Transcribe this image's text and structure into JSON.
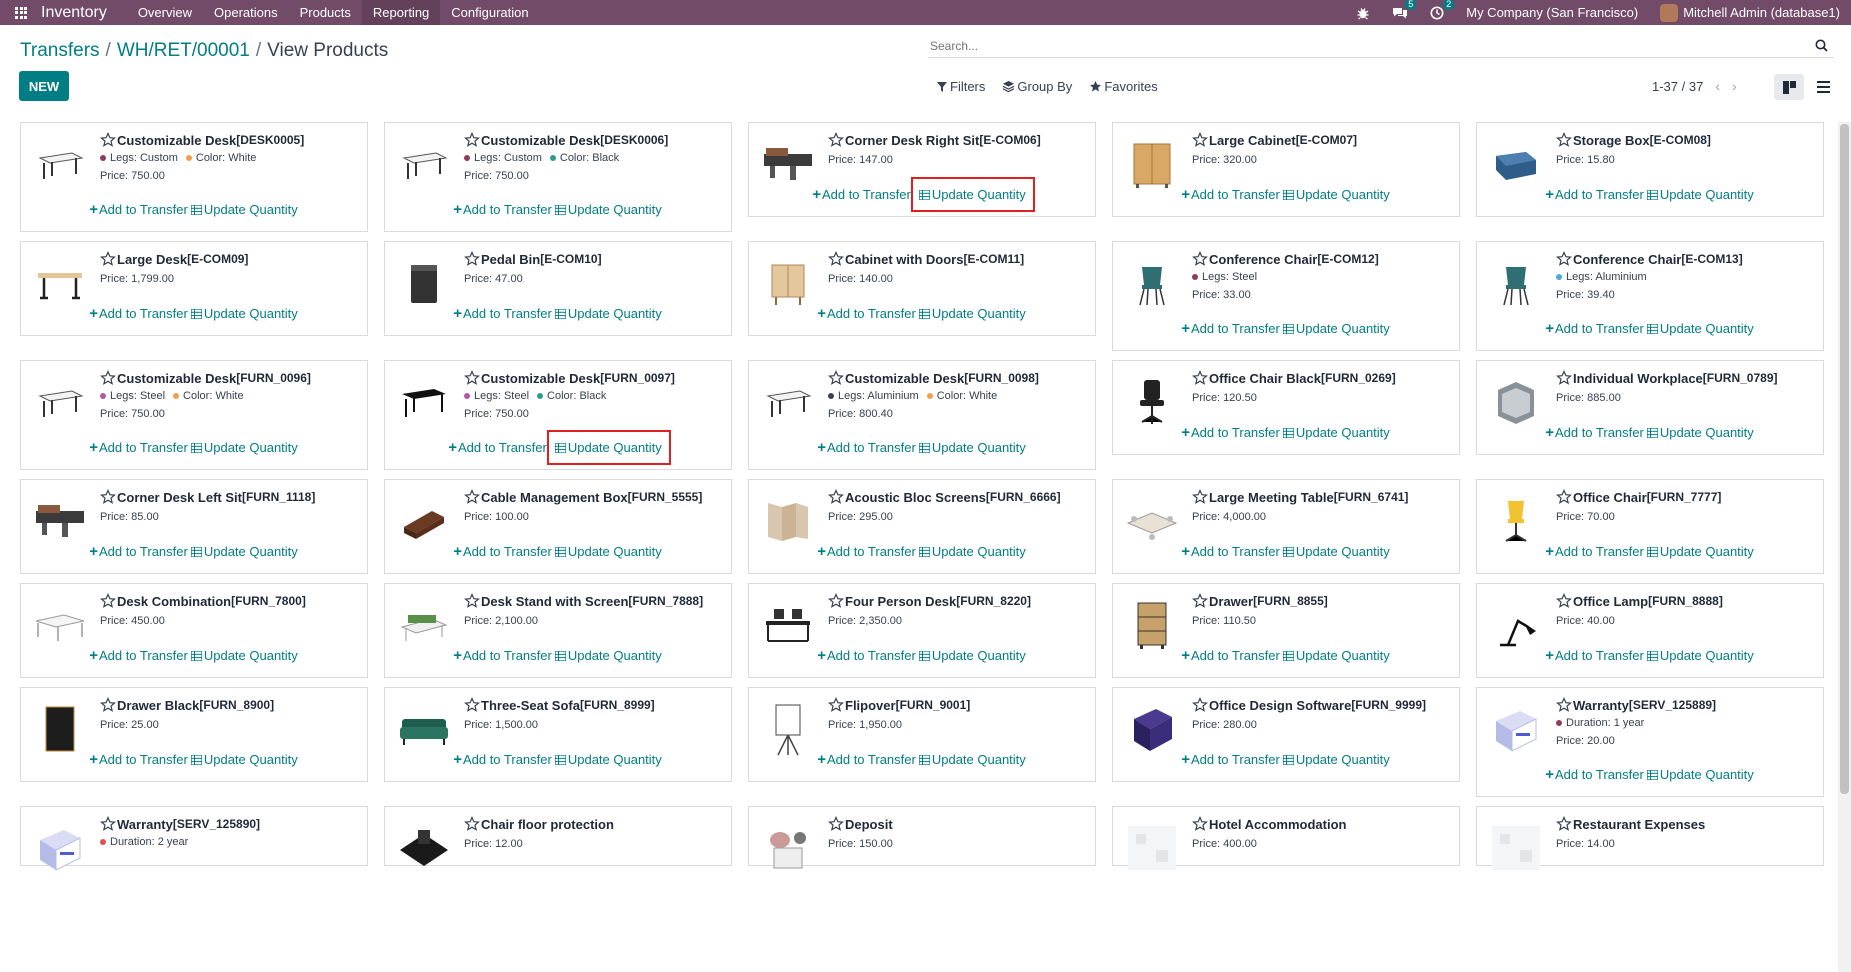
{
  "navbar": {
    "app_name": "Inventory",
    "menu": [
      "Overview",
      "Operations",
      "Products",
      "Reporting",
      "Configuration"
    ],
    "active_menu": "Reporting",
    "messages_badge": "5",
    "activities_badge": "2",
    "company": "My Company (San Francisco)",
    "user": "Mitchell Admin (database1)"
  },
  "breadcrumb": [
    "Transfers",
    "WH/RET/00001",
    "View Products"
  ],
  "search": {
    "placeholder": "Search..."
  },
  "buttons": {
    "new": "NEW",
    "filters": "Filters",
    "group_by": "Group By",
    "favorites": "Favorites"
  },
  "pager": {
    "value": "1-37 / 37"
  },
  "colors": {
    "navbar": "#714b67",
    "primary": "#017e84",
    "highlight": "#e02020"
  },
  "actions": {
    "add": "Add to Transfer",
    "update": "Update Quantity"
  },
  "products": [
    {
      "name": "Customizable Desk",
      "code": "[DESK0005]",
      "attrs": [
        {
          "label": "Legs: Custom",
          "color": "#8e3b5e"
        },
        {
          "label": "Color: White",
          "color": "#f0a04b"
        }
      ],
      "price": "Price: 750.00",
      "thumb": "desk-white",
      "highlight": false
    },
    {
      "name": "Customizable Desk",
      "code": "[DESK0006]",
      "attrs": [
        {
          "label": "Legs: Custom",
          "color": "#8e3b5e"
        },
        {
          "label": "Color: Black",
          "color": "#2a9d8f"
        }
      ],
      "price": "Price: 750.00",
      "thumb": "desk-white",
      "highlight": false
    },
    {
      "name": "Corner Desk Right Sit",
      "code": "[E-COM06]",
      "attrs": [],
      "price": "Price: 147.00",
      "thumb": "corner-desk",
      "highlight": true
    },
    {
      "name": "Large Cabinet",
      "code": "[E-COM07]",
      "attrs": [],
      "price": "Price: 320.00",
      "thumb": "cabinet",
      "highlight": false
    },
    {
      "name": "Storage Box",
      "code": "[E-COM08]",
      "attrs": [],
      "price": "Price: 15.80",
      "thumb": "storage-box",
      "highlight": false
    },
    {
      "name": "Large Desk",
      "code": "[E-COM09]",
      "attrs": [],
      "price": "Price: 1,799.00",
      "thumb": "large-desk",
      "highlight": false
    },
    {
      "name": "Pedal Bin",
      "code": "[E-COM10]",
      "attrs": [],
      "price": "Price: 47.00",
      "thumb": "pedal-bin",
      "highlight": false
    },
    {
      "name": "Cabinet with Doors",
      "code": "[E-COM11]",
      "attrs": [],
      "price": "Price: 140.00",
      "thumb": "cabinet-doors",
      "highlight": false
    },
    {
      "name": "Conference Chair",
      "code": "[E-COM12]",
      "attrs": [
        {
          "label": "Legs: Steel",
          "color": "#8e3b5e"
        }
      ],
      "price": "Price: 33.00",
      "thumb": "conf-chair",
      "highlight": false
    },
    {
      "name": "Conference Chair",
      "code": "[E-COM13]",
      "attrs": [
        {
          "label": "Legs: Aluminium",
          "color": "#4ea8de"
        }
      ],
      "price": "Price: 39.40",
      "thumb": "conf-chair",
      "highlight": false
    },
    {
      "name": "Customizable Desk",
      "code": "[FURN_0096]",
      "attrs": [
        {
          "label": "Legs: Steel",
          "color": "#b05aa6"
        },
        {
          "label": "Color: White",
          "color": "#f0a04b"
        }
      ],
      "price": "Price: 750.00",
      "thumb": "desk-white",
      "highlight": false
    },
    {
      "name": "Customizable Desk",
      "code": "[FURN_0097]",
      "attrs": [
        {
          "label": "Legs: Steel",
          "color": "#b05aa6"
        },
        {
          "label": "Color: Black",
          "color": "#2a9d8f"
        }
      ],
      "price": "Price: 750.00",
      "thumb": "desk-black",
      "highlight": true
    },
    {
      "name": "Customizable Desk",
      "code": "[FURN_0098]",
      "attrs": [
        {
          "label": "Legs: Aluminium",
          "color": "#374151"
        },
        {
          "label": "Color: White",
          "color": "#f0a04b"
        }
      ],
      "price": "Price: 800.40",
      "thumb": "desk-white",
      "highlight": false
    },
    {
      "name": "Office Chair Black",
      "code": "[FURN_0269]",
      "attrs": [],
      "price": "Price: 120.50",
      "thumb": "office-chair-black",
      "highlight": false
    },
    {
      "name": "Individual Workplace",
      "code": "[FURN_0789]",
      "attrs": [],
      "price": "Price: 885.00",
      "thumb": "workplace",
      "highlight": false
    },
    {
      "name": "Corner Desk Left Sit",
      "code": "[FURN_1118]",
      "attrs": [],
      "price": "Price: 85.00",
      "thumb": "corner-desk",
      "highlight": false
    },
    {
      "name": "Cable Management Box",
      "code": "[FURN_5555]",
      "attrs": [],
      "price": "Price: 100.00",
      "thumb": "cable-box",
      "highlight": false
    },
    {
      "name": "Acoustic Bloc Screens",
      "code": "[FURN_6666]",
      "attrs": [],
      "price": "Price: 295.00",
      "thumb": "screens",
      "highlight": false
    },
    {
      "name": "Large Meeting Table",
      "code": "[FURN_6741]",
      "attrs": [],
      "price": "Price: 4,000.00",
      "thumb": "meeting-table",
      "highlight": false
    },
    {
      "name": "Office Chair",
      "code": "[FURN_7777]",
      "attrs": [],
      "price": "Price: 70.00",
      "thumb": "office-chair",
      "highlight": false
    },
    {
      "name": "Desk Combination",
      "code": "[FURN_7800]",
      "attrs": [],
      "price": "Price: 450.00",
      "thumb": "desk-combo",
      "highlight": false
    },
    {
      "name": "Desk Stand with Screen",
      "code": "[FURN_7888]",
      "attrs": [],
      "price": "Price: 2,100.00",
      "thumb": "desk-stand",
      "highlight": false
    },
    {
      "name": "Four Person Desk",
      "code": "[FURN_8220]",
      "attrs": [],
      "price": "Price: 2,350.00",
      "thumb": "four-desk",
      "highlight": false
    },
    {
      "name": "Drawer",
      "code": "[FURN_8855]",
      "attrs": [],
      "price": "Price: 110.50",
      "thumb": "drawer",
      "highlight": false
    },
    {
      "name": "Office Lamp",
      "code": "[FURN_8888]",
      "attrs": [],
      "price": "Price: 40.00",
      "thumb": "lamp",
      "highlight": false
    },
    {
      "name": "Drawer Black",
      "code": "[FURN_8900]",
      "attrs": [],
      "price": "Price: 25.00",
      "thumb": "drawer-black",
      "highlight": false
    },
    {
      "name": "Three-Seat Sofa",
      "code": "[FURN_8999]",
      "attrs": [],
      "price": "Price: 1,500.00",
      "thumb": "sofa",
      "highlight": false
    },
    {
      "name": "Flipover",
      "code": "[FURN_9001]",
      "attrs": [],
      "price": "Price: 1,950.00",
      "thumb": "flipover",
      "highlight": false
    },
    {
      "name": "Office Design Software",
      "code": "[FURN_9999]",
      "attrs": [],
      "price": "Price: 280.00",
      "thumb": "software",
      "highlight": false
    },
    {
      "name": "Warranty",
      "code": "[SERV_125889]",
      "attrs": [
        {
          "label": "Duration: 1 year",
          "color": "#8e3b5e"
        }
      ],
      "price": "Price: 20.00",
      "thumb": "warranty",
      "highlight": false
    },
    {
      "name": "Warranty",
      "code": "[SERV_125890]",
      "attrs": [
        {
          "label": "Duration: 2 year",
          "color": "#e0524d"
        }
      ],
      "price": "",
      "thumb": "warranty",
      "highlight": false
    },
    {
      "name": "Chair floor protection",
      "code": "",
      "attrs": [],
      "price": "Price: 12.00",
      "thumb": "floor-protection",
      "highlight": false
    },
    {
      "name": "Deposit",
      "code": "",
      "attrs": [],
      "price": "Price: 150.00",
      "thumb": "deposit",
      "highlight": false
    },
    {
      "name": "Hotel Accommodation",
      "code": "",
      "attrs": [],
      "price": "Price: 400.00",
      "thumb": "placeholder",
      "highlight": false
    },
    {
      "name": "Restaurant Expenses",
      "code": "",
      "attrs": [],
      "price": "Price: 14.00",
      "thumb": "placeholder",
      "highlight": false
    }
  ]
}
